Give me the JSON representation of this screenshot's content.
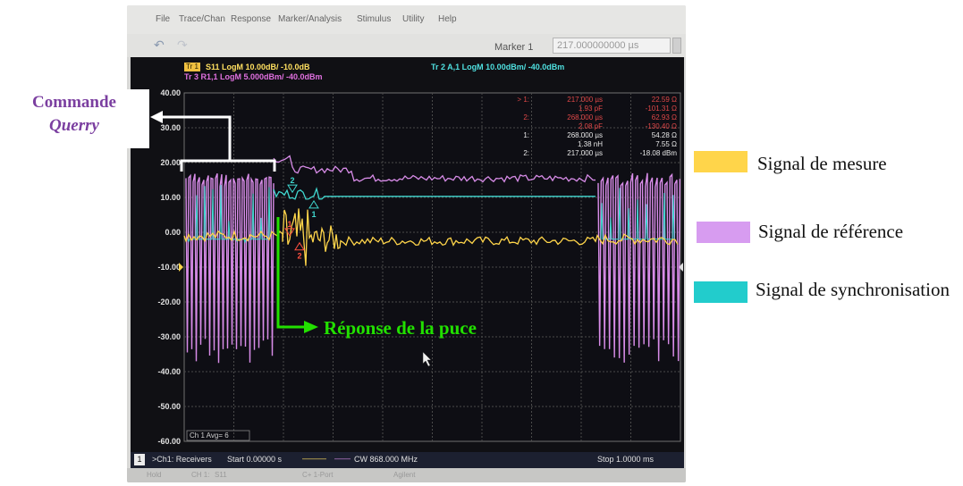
{
  "menu": [
    "File",
    "Trace/Chan",
    "Response",
    "Marker/Analysis",
    "Stimulus",
    "Utility",
    "Help"
  ],
  "toolbar": {
    "undo_icon": "undo-icon",
    "redo_icon": "redo-icon",
    "marker_label": "Marker 1",
    "marker_value": "217.000000000 µs"
  },
  "traces": {
    "tr1_badge": "Tr 1",
    "tr1": "S11 LogM 10.00dB/ -10.0dB",
    "tr2": "Tr 2 A,1 LogM 10.00dBm/ -40.0dBm",
    "tr3": "Tr 3 R1,1 LogM 5.000dBm/ -40.0dBm"
  },
  "marker_table": [
    {
      "id": "> 1:",
      "pos": "217.000 µs",
      "val": "22.59 Ω",
      "color": "#e04848"
    },
    {
      "id": "",
      "pos": "1.93 pF",
      "val": "-101.31 Ω",
      "color": "#e04848"
    },
    {
      "id": "2:",
      "pos": "268.000 µs",
      "val": "62.93 Ω",
      "color": "#e04848"
    },
    {
      "id": "",
      "pos": "2.08 pF",
      "val": "-130.40 Ω",
      "color": "#e04848"
    },
    {
      "id": "1:",
      "pos": "268.000 µs",
      "val": "54.28 Ω",
      "color": "#e8e8e8"
    },
    {
      "id": "",
      "pos": "1.38 nH",
      "val": "7.55 Ω",
      "color": "#e8e8e8"
    },
    {
      "id": "2:",
      "pos": "217.000 µs",
      "val": "-18.08 dBm",
      "color": "#e8e8e8"
    }
  ],
  "y_ticks": [
    "40.00",
    "30.00",
    "20.00",
    "10.00",
    "0.00",
    "-10.00",
    "-20.00",
    "-30.00",
    "-40.00",
    "-50.00",
    "-60.00"
  ],
  "avg_label": "Ch 1 Avg= 6",
  "marker_flags": {
    "cyan_top": "2",
    "cyan_bottom": "1",
    "red_1": "1",
    "red_2": "2"
  },
  "status": {
    "channel": "1",
    "receivers": ">Ch1: Receivers",
    "start": "Start 0.00000 s",
    "cw": "CW 868.000 MHz",
    "stop": "Stop 1.0000 ms"
  },
  "bottom_strip": [
    "Hold",
    "CH 1:",
    "S11",
    "C+ 1-Port",
    "Agilent"
  ],
  "annotations": {
    "command_title": "Commande",
    "command_sub": "Querry",
    "response": "Réponse de la puce"
  },
  "legend": [
    {
      "label": "Signal de mesure",
      "color": "#ffd54a"
    },
    {
      "label": "Signal de référence",
      "color": "#d79cf0"
    },
    {
      "label": "Signal de synchronisation",
      "color": "#22cccc"
    }
  ],
  "colors": {
    "measure": "#ffd54a",
    "reference": "#d88ce8",
    "sync": "#40d8d0",
    "annot_white": "#ffffff",
    "annot_green": "#22e000",
    "annot_purple": "#7b3fa0"
  }
}
